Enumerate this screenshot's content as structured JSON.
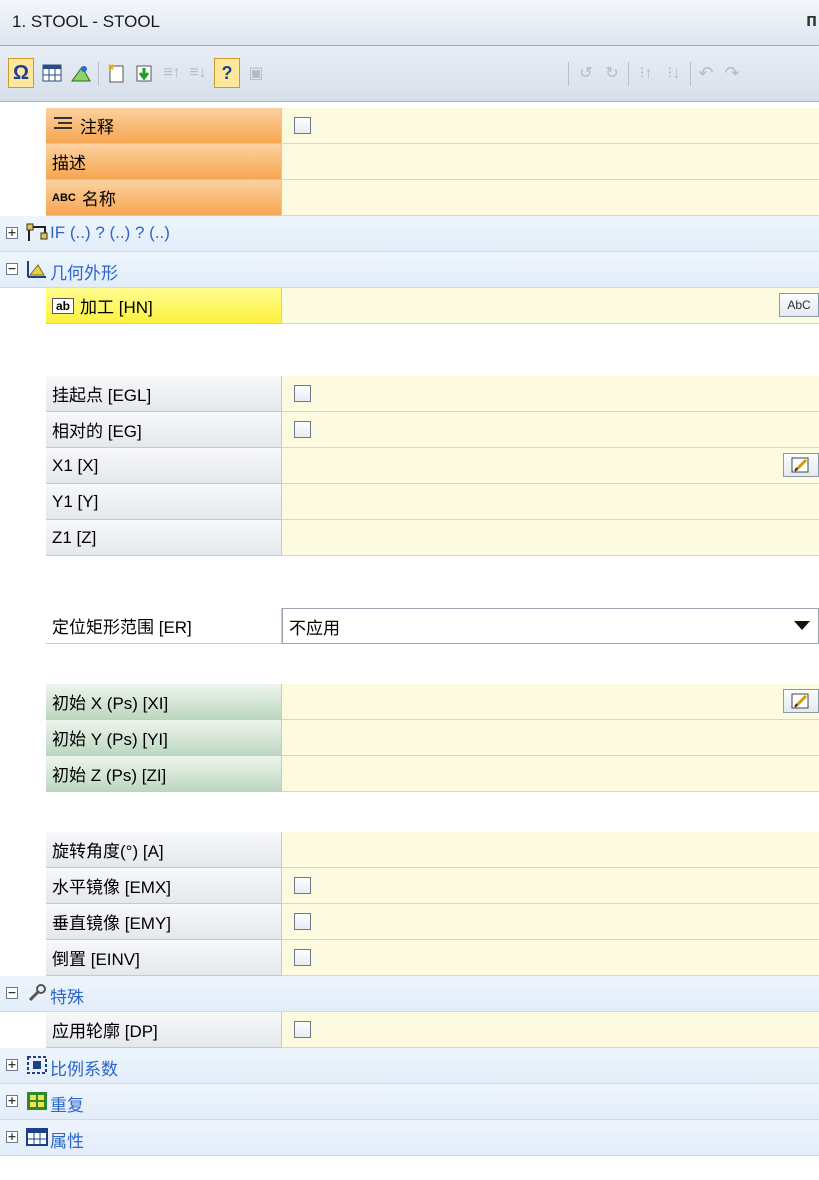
{
  "window": {
    "title": "1. STOOL - STOOL",
    "pin_glyph": "ᴨ"
  },
  "toolbar": {
    "icons": [
      "omega-icon",
      "grid-icon",
      "geometry-icon",
      "new-icon",
      "download-icon",
      "list-up-icon",
      "list-down-icon",
      "help-icon",
      "disabled-icon",
      "rotate-icon",
      "rotate2-icon",
      "move-up-icon",
      "move-down-icon",
      "undo-icon",
      "redo-icon"
    ]
  },
  "rows": {
    "note": {
      "label": "注释"
    },
    "desc": {
      "label": "描述"
    },
    "name": {
      "label": "名称",
      "abc_prefix": "ABC"
    },
    "if_section": {
      "label": "IF (..) ? (..) ? (..)",
      "expander": "+"
    },
    "geometry_section": {
      "label": "几何外形",
      "expander": "−"
    },
    "machining": {
      "label": "加工 [HN]",
      "ab_prefix": "ab",
      "button": "AbC"
    },
    "hook": {
      "label": "挂起点 [EGL]"
    },
    "relative": {
      "label": "相对的 [EG]"
    },
    "x1": {
      "label": "X1 [X]"
    },
    "y1": {
      "label": "Y1 [Y]"
    },
    "z1": {
      "label": "Z1 [Z]"
    },
    "locate_rect": {
      "label": "定位矩形范围 [ER]",
      "value": "不应用"
    },
    "init_x": {
      "label": "初始 X (Ps) [XI]"
    },
    "init_y": {
      "label": "初始 Y (Ps) [YI]"
    },
    "init_z": {
      "label": "初始 Z (Ps) [ZI]"
    },
    "rot_angle": {
      "label": "旋转角度(°) [A]"
    },
    "mirror_h": {
      "label": "水平镜像 [EMX]"
    },
    "mirror_v": {
      "label": "垂直镜像 [EMY]"
    },
    "invert": {
      "label": "倒置 [EINV]"
    },
    "special_section": {
      "label": "特殊",
      "expander": "−"
    },
    "apply_profile": {
      "label": "应用轮廓 [DP]"
    },
    "scale_section": {
      "label": "比例系数",
      "expander": "+"
    },
    "repeat_section": {
      "label": "重复",
      "expander": "+"
    },
    "props_section": {
      "label": "属性",
      "expander": "+"
    }
  },
  "colors": {
    "section_text": "#2b66c8",
    "value_bg": "#fdfbdf",
    "orange_label": "#f7a54f",
    "yellow_label": "#fdf23e",
    "green_label": "#bcd7bf"
  }
}
